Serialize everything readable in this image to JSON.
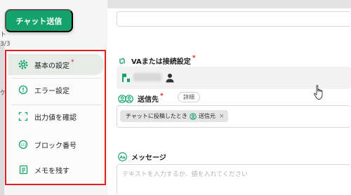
{
  "colors": {
    "accent_green": "#14a36a",
    "highlight_red": "#e0201e",
    "required_red": "#e0201e"
  },
  "send_button": {
    "label": "チャット送信"
  },
  "sidebar_fragments": [
    "ト",
    "3/3",
    "ケ"
  ],
  "menu": {
    "items": [
      {
        "name": "basic-settings",
        "label": "基本の設定",
        "icon": "gear-icon",
        "required": "*",
        "active": true
      },
      {
        "name": "error-settings",
        "label": "エラー設定",
        "icon": "alert-circle-icon",
        "required": ""
      },
      {
        "name": "check-output",
        "label": "出力値を確認",
        "icon": "output-frame-icon",
        "required": ""
      },
      {
        "name": "block-number",
        "label": "ブロック番号",
        "icon": "number-badge-icon",
        "required": ""
      },
      {
        "name": "leave-memo",
        "label": "メモを残す",
        "icon": "memo-icon",
        "required": ""
      }
    ]
  },
  "form": {
    "va_connection": {
      "label": "VAまたは接続設定",
      "required": "*",
      "icon": "link-icon"
    },
    "destination": {
      "label": "送信先",
      "required": "*",
      "detail_label": "詳細",
      "icon": "people-icon",
      "chip": {
        "prefix": "チャットに投稿したとき",
        "suffix": "送信元",
        "remove": "×"
      }
    },
    "message": {
      "label": "メッセージ",
      "icon": "text-aa-icon",
      "placeholder": "テキストを入力するか、値を入れてください"
    }
  }
}
